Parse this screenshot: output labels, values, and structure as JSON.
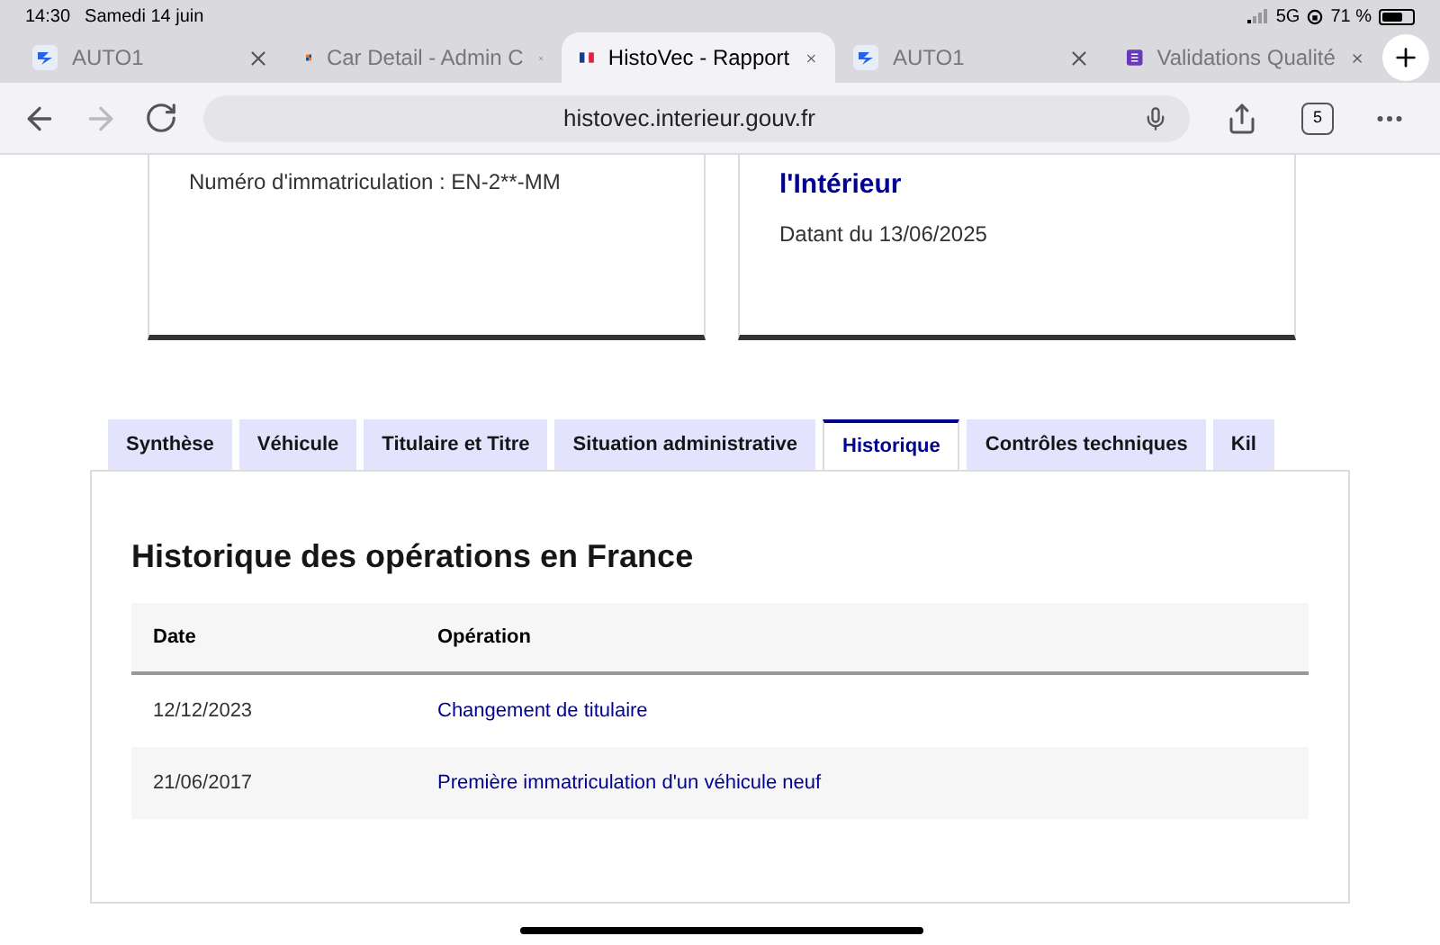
{
  "status_bar": {
    "time": "14:30",
    "date": "Samedi 14 juin",
    "network": "5G",
    "battery": "71 %"
  },
  "browser_tabs": [
    {
      "title": "AUTO1",
      "kind": "auto",
      "selected": false
    },
    {
      "title": "Car Detail - Admin C",
      "kind": "grid",
      "selected": false
    },
    {
      "title": "HistoVec - Rapport",
      "kind": "flag",
      "selected": true
    },
    {
      "title": "AUTO1",
      "kind": "auto",
      "selected": false
    },
    {
      "title": "Validations Qualité",
      "kind": "form",
      "selected": false
    }
  ],
  "address_bar": {
    "url": "histovec.interieur.gouv.fr",
    "tab_count": "5"
  },
  "cards": [
    {
      "text": "Numéro d'immatriculation : EN-2**-MM"
    },
    {
      "title": "l'Intérieur",
      "text": "Datant du 13/06/2025"
    }
  ],
  "tabs": [
    {
      "label": "Synthèse",
      "selected": false
    },
    {
      "label": "Véhicule",
      "selected": false
    },
    {
      "label": "Titulaire et Titre",
      "selected": false
    },
    {
      "label": "Situation administrative",
      "selected": false
    },
    {
      "label": "Historique",
      "selected": true
    },
    {
      "label": "Contrôles techniques",
      "selected": false
    },
    {
      "label": "Kil",
      "selected": false
    }
  ],
  "section": {
    "title": "Historique des opérations en France"
  },
  "table": {
    "columns": [
      "Date",
      "Opération"
    ],
    "rows": [
      [
        "12/12/2023",
        "Changement de titulaire"
      ],
      [
        "21/06/2017",
        "Première immatriculation d'un véhicule neuf"
      ]
    ]
  }
}
